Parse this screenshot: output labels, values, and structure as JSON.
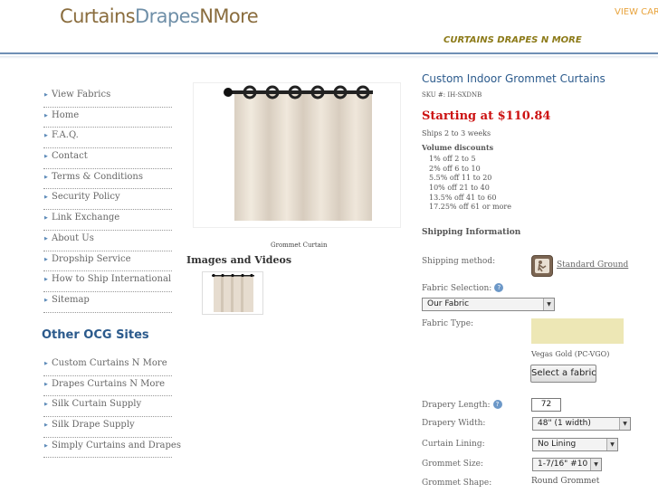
{
  "header": {
    "logo": {
      "part1": "Curtains",
      "part2": "Drapes",
      "part3": "NMore"
    },
    "view_cart": "VIEW CART",
    "tagline": "CURTAINS DRAPES N MORE"
  },
  "sidebar": {
    "nav_items": [
      {
        "label": "View Fabrics"
      },
      {
        "label": "Home"
      },
      {
        "label": "F.A.Q."
      },
      {
        "label": "Contact"
      },
      {
        "label": "Terms & Conditions"
      },
      {
        "label": "Security Policy"
      },
      {
        "label": "Link Exchange"
      },
      {
        "label": "About Us"
      },
      {
        "label": "Dropship Service"
      },
      {
        "label": "How to Ship International"
      },
      {
        "label": "Sitemap"
      }
    ],
    "other_sites_title": "Other OCG Sites",
    "other_sites": [
      {
        "label": "Custom Curtains N More"
      },
      {
        "label": "Drapes Curtains N More"
      },
      {
        "label": "Silk Curtain Supply"
      },
      {
        "label": "Silk Drape Supply"
      },
      {
        "label": "Simply Curtains and Drapes"
      }
    ]
  },
  "gallery": {
    "caption": "Grommet Curtain",
    "images_videos_title": "Images and Videos"
  },
  "product": {
    "title": "Custom Indoor Grommet Curtains",
    "sku": "SKU #: IH-SXDNB",
    "price": "Starting at $110.84",
    "ships": "Ships 2 to 3 weeks",
    "volume_discounts_title": "Volume discounts",
    "volume_discounts": [
      "1% off 2 to 5",
      "2% off 6 to 10",
      "5.5% off 11 to 20",
      "10% off 21 to 40",
      "13.5% off 41 to 60",
      "17.25% off 61 or more"
    ],
    "shipping_info_title": "Shipping Information"
  },
  "options": {
    "shipping_method_label": "Shipping method:",
    "shipping_method_value": "Standard Ground",
    "fabric_selection_label": "Fabric Selection:",
    "fabric_selection_value": "Our Fabric",
    "fabric_type_label": "Fabric Type:",
    "fabric_name": "Vegas Gold (PC-VGO)",
    "fabric_swatch_color": "#ede7b5",
    "select_fabric_button": "Select a fabric",
    "drapery_length_label": "Drapery Length:",
    "drapery_length_value": "72",
    "drapery_width_label": "Drapery Width:",
    "drapery_width_value": "48\" (1 width)",
    "curtain_lining_label": "Curtain Lining:",
    "curtain_lining_value": "No Lining",
    "grommet_size_label": "Grommet Size:",
    "grommet_size_value": "1-7/16\" #10",
    "grommet_shape_label": "Grommet Shape:",
    "grommet_shape_value": "Round Grommet"
  },
  "icons": {
    "help": "question-mark-icon",
    "shipping": "delivery-person-icon",
    "bullet": "bullet-icon"
  },
  "colors": {
    "accent": "#2b5a8c",
    "price": "#cc1111",
    "tagline": "#8c7a18",
    "cart": "#e8a33c"
  }
}
